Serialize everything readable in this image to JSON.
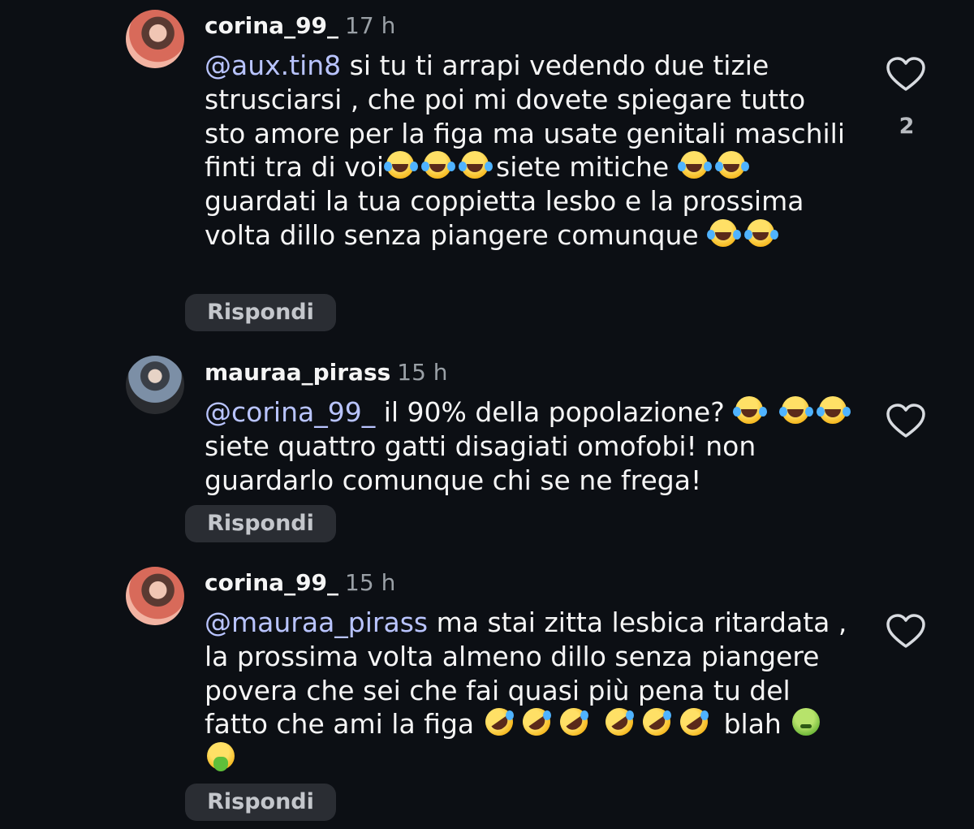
{
  "comments": [
    {
      "username": "corina_99_",
      "time": "17 h",
      "mention": "@aux.tin8",
      "text_1": " si tu ti arrapi vedendo due tizie strusciarsi , che poi mi dovete spiegare tutto sto amore per la figa ma usate genitali maschili finti tra di voi",
      "text_2": "siete mitiche",
      "text_3": "guardati la tua coppietta lesbo e la prossima volta dillo senza piangere comunque ",
      "reply_label": "Rispondi",
      "likes": "2"
    },
    {
      "username": "mauraa_pirass",
      "time": "15 h",
      "mention": "@corina_99_",
      "text_1": " il 90% della popolazione? ",
      "text_2": "siete quattro gatti disagiati omofobi! non guardarlo comunque chi se ne frega!",
      "reply_label": "Rispondi"
    },
    {
      "username": "corina_99_",
      "time": "15 h",
      "mention": "@mauraa_pirass",
      "text_1": " ma stai zitta lesbica ritardata , la prossima volta almeno dillo senza piangere povera che sei che fai quasi più pena tu del fatto che ami la figa ",
      "text_2": " blah ",
      "reply_label": "Rispondi"
    }
  ],
  "colors": {
    "background": "#0c0f14",
    "mention": "#b9c4ff",
    "secondary_text": "#9aa0a6",
    "reply_button": "#2a2d33"
  },
  "icons": {
    "like": "heart-outline-icon",
    "laugh": "face-with-tears-of-joy-emoji",
    "rofl": "rolling-on-floor-laughing-emoji",
    "sick": "nauseated-face-emoji",
    "vomit": "face-vomiting-emoji"
  }
}
